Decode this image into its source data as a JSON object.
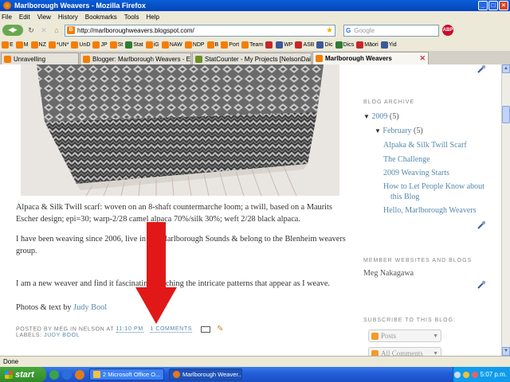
{
  "window": {
    "title": "Marlborough Weavers - Mozilla Firefox",
    "buttons": [
      "_",
      "□",
      "×"
    ]
  },
  "menu": [
    "File",
    "Edit",
    "View",
    "History",
    "Bookmarks",
    "Tools",
    "Help"
  ],
  "nav": {
    "url": "http://marlboroughweavers.blogspot.com/",
    "search_placeholder": "Google",
    "abp_label": "ABP"
  },
  "bookmarks": [
    {
      "label": "E",
      "icon": "blogger-icon"
    },
    {
      "label": "M",
      "icon": "blogger-icon"
    },
    {
      "label": "NZ",
      "icon": "blogger-icon"
    },
    {
      "label": "*UN*",
      "icon": "blogger-icon"
    },
    {
      "label": "UnD",
      "icon": "blogger-icon"
    },
    {
      "label": "JP",
      "icon": "blogger-icon"
    },
    {
      "label": "St",
      "icon": "blogger-icon"
    },
    {
      "label": "Stat",
      "icon": "stat-icon"
    },
    {
      "label": "iG",
      "icon": "blogger-icon"
    },
    {
      "label": "NAW",
      "icon": "blogger-icon"
    },
    {
      "label": "NDP",
      "icon": "blogger-icon"
    },
    {
      "label": "B",
      "icon": "blogger-icon"
    },
    {
      "label": "Port",
      "icon": "blogger-icon"
    },
    {
      "label": "Team",
      "icon": "blogger-icon"
    },
    {
      "label": "",
      "icon": "flag-icon"
    },
    {
      "label": "WP",
      "icon": "wp-icon"
    },
    {
      "label": "ASB",
      "icon": "asb-icon"
    },
    {
      "label": "Dic",
      "icon": "dic-icon"
    },
    {
      "label": "Dics",
      "icon": "dics-icon"
    },
    {
      "label": "Māori",
      "icon": "maori-icon"
    },
    {
      "label": "Yid",
      "icon": "yid-icon"
    }
  ],
  "tabs": [
    {
      "label": "Unravelling",
      "active": false
    },
    {
      "label": "Blogger: Marlborough Weavers - Edit ...",
      "active": false
    },
    {
      "label": "StatCounter - My Projects [NelsonDail...",
      "active": false
    },
    {
      "label": "Marlborough Weavers",
      "active": true
    }
  ],
  "post": {
    "caption": "Alpaca & Silk Twill scarf: woven on an 8-shaft countermarche loom; a twill, based on a Maurits Escher design; epi=30; warp-2/28 camel alpaca 70%/silk 30%; weft 2/28 black alpaca.",
    "para1": "I have been weaving since 2006, live in the Marlborough Sounds & belong to the Blenheim weavers group.",
    "para2": "I am a new weaver and find it fascinating watching the intricate patterns that appear as I weave.",
    "credit_prefix": "Photos & text by ",
    "credit_link": "Judy Bool",
    "posted_by": "POSTED BY MEG IN NELSON AT ",
    "time": "11:10 PM",
    "comments": "1 COMMENTS",
    "labels_prefix": "LABELS: ",
    "labels_value": "JUDY BOOL"
  },
  "sidebar": {
    "archive_title": "BLOG ARCHIVE",
    "year": "2009",
    "year_count": "(5)",
    "month": "February",
    "month_count": "(5)",
    "posts": [
      "Alpaka & Silk Twill Scarf",
      "The Challenge",
      "2009 Weaving Starts",
      "How to Let People Know about",
      "this Blog",
      "Hello, Marlborough Weavers"
    ],
    "members_title": "MEMBER WEBSITES AND BLOGS",
    "member": "Meg Nakagawa",
    "subscribe_title": "SUBSCRIBE TO THIS BLOG:",
    "subscribe_posts": "Posts",
    "subscribe_comments": "All Comments"
  },
  "status": "Done",
  "taskbar": {
    "start": "start",
    "tasks": [
      "2 Microsoft Office O...",
      "Marlborough Weaver..."
    ],
    "clock": "5:07 p.m."
  },
  "colors": {
    "link": "#5588aa",
    "arrow": "#e21818",
    "taskbar": "#245edb"
  }
}
